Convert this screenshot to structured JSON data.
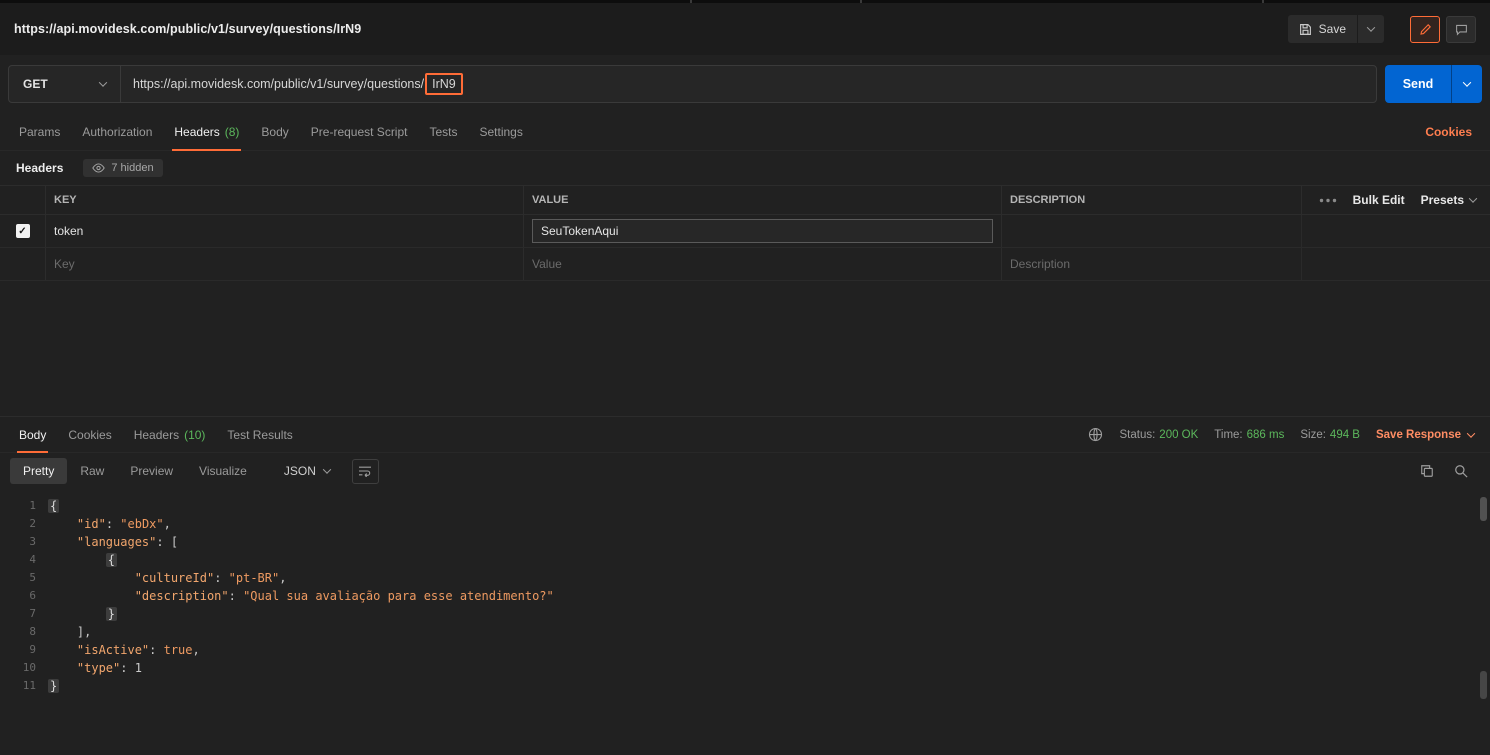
{
  "header": {
    "title": "https://api.movidesk.com/public/v1/survey/questions/IrN9",
    "save_label": "Save"
  },
  "request": {
    "method": "GET",
    "url_prefix": "https://api.movidesk.com/public/v1/survey/questions/",
    "url_highlight": "IrN9",
    "send_label": "Send"
  },
  "request_tabs": [
    {
      "label": "Params"
    },
    {
      "label": "Authorization"
    },
    {
      "label": "Headers",
      "count": "(8)"
    },
    {
      "label": "Body"
    },
    {
      "label": "Pre-request Script"
    },
    {
      "label": "Tests"
    },
    {
      "label": "Settings"
    }
  ],
  "cookies_link": "Cookies",
  "headers_editor": {
    "title": "Headers",
    "hidden_badge": "7 hidden",
    "columns": [
      "KEY",
      "VALUE",
      "DESCRIPTION"
    ],
    "bulk_edit_label": "Bulk Edit",
    "presets_label": "Presets",
    "rows": [
      {
        "key": "token",
        "value": "SeuTokenAqui",
        "description": ""
      }
    ],
    "placeholder_row": {
      "key": "Key",
      "value": "Value",
      "description": "Description"
    }
  },
  "response": {
    "tabs": [
      {
        "label": "Body"
      },
      {
        "label": "Cookies"
      },
      {
        "label": "Headers",
        "count": "(10)"
      },
      {
        "label": "Test Results"
      }
    ],
    "status_label": "Status:",
    "status_value": "200 OK",
    "time_label": "Time:",
    "time_value": "686 ms",
    "size_label": "Size:",
    "size_value": "494 B",
    "save_response_label": "Save Response",
    "view_tabs": [
      "Pretty",
      "Raw",
      "Preview",
      "Visualize"
    ],
    "format_selected": "JSON",
    "code": {
      "lines": [
        [
          {
            "c": "brace",
            "v": "{"
          }
        ],
        [
          {
            "c": "p",
            "v": "    "
          },
          {
            "c": "k",
            "v": "\"id\""
          },
          {
            "c": "p",
            "v": ": "
          },
          {
            "c": "s",
            "v": "\"ebDx\""
          },
          {
            "c": "p",
            "v": ","
          }
        ],
        [
          {
            "c": "p",
            "v": "    "
          },
          {
            "c": "k",
            "v": "\"languages\""
          },
          {
            "c": "p",
            "v": ": ["
          }
        ],
        [
          {
            "c": "p",
            "v": "        "
          },
          {
            "c": "brace",
            "v": "{"
          }
        ],
        [
          {
            "c": "p",
            "v": "            "
          },
          {
            "c": "k",
            "v": "\"cultureId\""
          },
          {
            "c": "p",
            "v": ": "
          },
          {
            "c": "s",
            "v": "\"pt-BR\""
          },
          {
            "c": "p",
            "v": ","
          }
        ],
        [
          {
            "c": "p",
            "v": "            "
          },
          {
            "c": "k",
            "v": "\"description\""
          },
          {
            "c": "p",
            "v": ": "
          },
          {
            "c": "s",
            "v": "\"Qual sua avaliação para esse atendimento?\""
          }
        ],
        [
          {
            "c": "p",
            "v": "        "
          },
          {
            "c": "brace",
            "v": "}"
          }
        ],
        [
          {
            "c": "p",
            "v": "    "
          },
          {
            "c": "p",
            "v": "],"
          }
        ],
        [
          {
            "c": "p",
            "v": "    "
          },
          {
            "c": "k",
            "v": "\"isActive\""
          },
          {
            "c": "p",
            "v": ": "
          },
          {
            "c": "b",
            "v": "true"
          },
          {
            "c": "p",
            "v": ","
          }
        ],
        [
          {
            "c": "p",
            "v": "    "
          },
          {
            "c": "k",
            "v": "\"type\""
          },
          {
            "c": "p",
            "v": ": "
          },
          {
            "c": "n",
            "v": "1"
          }
        ],
        [
          {
            "c": "brace",
            "v": "}"
          }
        ]
      ]
    }
  },
  "icons": {
    "save": "floppy-icon",
    "edit": "pencil-icon",
    "comments": "comment-icon",
    "hidden": "eye-icon",
    "more": "more-dots-icon",
    "network": "globe-icon",
    "wrap": "wrap-text-icon",
    "copy": "copy-icon",
    "search": "search-icon"
  },
  "colors": {
    "accent_orange": "#ff6c37",
    "send_blue": "#0265d2",
    "success_green": "#5cb85c",
    "json_key": "#f2a66d",
    "json_string": "#ee9a61",
    "background": "#212121"
  }
}
